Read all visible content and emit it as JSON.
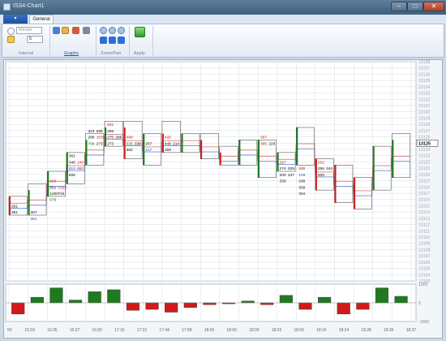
{
  "window": {
    "title": "ISS4-Chart1"
  },
  "tabs": {
    "file": "",
    "general": "General"
  },
  "ribbon": {
    "interval": {
      "group_label": "Interval",
      "unit": "Minute",
      "value": "5"
    },
    "graphs": {
      "group_label": "Graphs"
    },
    "zoom": {
      "group_label": "Zoom/Pan"
    },
    "apply": {
      "group_label": "Apply"
    }
  },
  "chart_data": {
    "type": "footprint-candlestick",
    "price_axis": {
      "ylim": [
        13103,
        13138
      ],
      "tick_labels": [
        "13138",
        "13137",
        "13136",
        "13135",
        "13134",
        "13133",
        "13132",
        "13131",
        "13130",
        "13129",
        "13128",
        "13127",
        "13126",
        "13125",
        "13124",
        "13123",
        "13122",
        "13121",
        "13120",
        "13119",
        "13118",
        "13117",
        "13116",
        "13115",
        "13114",
        "13113",
        "13112",
        "13111",
        "13110",
        "13109",
        "13108",
        "13107",
        "13106",
        "13105",
        "13104",
        "13103"
      ],
      "current_price_label": "13125"
    },
    "volume_axis": {
      "labels": [
        "1000",
        "0",
        "-1000"
      ]
    },
    "time_labels": [
      "50",
      "15:59",
      "16:35",
      "16:37",
      "16:50",
      "17:16",
      "17:31",
      "17:44",
      "17:58",
      "18:00",
      "18:00",
      "18:00",
      "18:03",
      "18:09",
      "18:16",
      "18:24",
      "18:28",
      "18:36",
      "18:37"
    ],
    "bars": [
      {
        "low": 13114,
        "high": 13116,
        "open": 13116,
        "close": 13114
      },
      {
        "low": 13114,
        "high": 13118,
        "open": 13114,
        "close": 13117
      },
      {
        "low": 13117,
        "high": 13120,
        "open": 13117,
        "close": 13120
      },
      {
        "low": 13119,
        "high": 13123,
        "open": 13119,
        "close": 13123
      },
      {
        "low": 13122,
        "high": 13126,
        "open": 13122,
        "close": 13125
      },
      {
        "low": 13125,
        "high": 13128,
        "open": 13125,
        "close": 13127
      },
      {
        "low": 13123,
        "high": 13128,
        "open": 13127,
        "close": 13123
      },
      {
        "low": 13122,
        "high": 13126,
        "open": 13122,
        "close": 13126
      },
      {
        "low": 13124,
        "high": 13128,
        "open": 13126,
        "close": 13124
      },
      {
        "low": 13124,
        "high": 13126,
        "open": 13124,
        "close": 13126
      },
      {
        "low": 13123,
        "high": 13126,
        "open": 13125,
        "close": 13123
      },
      {
        "low": 13122,
        "high": 13124,
        "open": 13123,
        "close": 13122
      },
      {
        "low": 13122,
        "high": 13125,
        "open": 13122,
        "close": 13125
      },
      {
        "low": 13120,
        "high": 13125,
        "open": 13120,
        "close": 13125
      },
      {
        "low": 13121,
        "high": 13123,
        "open": 13121,
        "close": 13123
      },
      {
        "low": 13122,
        "high": 13127,
        "open": 13122,
        "close": 13127
      },
      {
        "low": 13118,
        "high": 13122,
        "open": 13122,
        "close": 13118
      },
      {
        "low": 13116,
        "high": 13121,
        "open": 13121,
        "close": 13116
      },
      {
        "low": 13115,
        "high": 13119,
        "open": 13119,
        "close": 13115
      },
      {
        "low": 13118,
        "high": 13124,
        "open": 13118,
        "close": 13124
      },
      {
        "low": 13120,
        "high": 13126,
        "open": 13120,
        "close": 13125
      }
    ],
    "cell_labels": [
      {
        "bar": 0,
        "price": 13115,
        "text": "261",
        "color": "black"
      },
      {
        "bar": 0,
        "price": 13114,
        "text": "391",
        "color": "black"
      },
      {
        "bar": 1,
        "price": 13113,
        "text": "351",
        "color": "blue"
      },
      {
        "bar": 1,
        "price": 13114,
        "text": "307",
        "color": "black"
      },
      {
        "bar": 2,
        "price": 13119,
        "text": "620",
        "color": "red"
      },
      {
        "bar": 2,
        "price": 13118,
        "text": "551",
        "color": "black"
      },
      {
        "bar": 2,
        "price": 13118,
        "text": "1323",
        "color": "red"
      },
      {
        "bar": 2,
        "price": 13117,
        "text": "1200",
        "color": "black"
      },
      {
        "bar": 2,
        "price": 13117,
        "text": "734",
        "color": "black"
      },
      {
        "bar": 2,
        "price": 13116,
        "text": "679",
        "color": "green"
      },
      {
        "bar": 3,
        "price": 13123,
        "text": "361",
        "color": "black"
      },
      {
        "bar": 3,
        "price": 13122,
        "text": "348",
        "color": "black"
      },
      {
        "bar": 3,
        "price": 13122,
        "text": "249",
        "color": "red"
      },
      {
        "bar": 3,
        "price": 13121,
        "text": "613",
        "color": "blue"
      },
      {
        "bar": 3,
        "price": 13121,
        "text": "653",
        "color": "red"
      },
      {
        "bar": 3,
        "price": 13120,
        "text": "606",
        "color": "black"
      },
      {
        "bar": 4,
        "price": 13127,
        "text": "323",
        "color": "black"
      },
      {
        "bar": 4,
        "price": 13127,
        "text": "596",
        "color": "black"
      },
      {
        "bar": 4,
        "price": 13126,
        "text": "286",
        "color": "black"
      },
      {
        "bar": 4,
        "price": 13126,
        "text": "1039",
        "color": "red"
      },
      {
        "bar": 4,
        "price": 13125,
        "text": "796",
        "color": "green"
      },
      {
        "bar": 4,
        "price": 13125,
        "text": "273",
        "color": "black"
      },
      {
        "bar": 5,
        "price": 13128,
        "text": "602",
        "color": "red"
      },
      {
        "bar": 5,
        "price": 13127,
        "text": "269",
        "color": "black"
      },
      {
        "bar": 5,
        "price": 13126,
        "text": "275",
        "color": "black"
      },
      {
        "bar": 5,
        "price": 13126,
        "text": "286",
        "color": "black"
      },
      {
        "bar": 5,
        "price": 13125,
        "text": "273",
        "color": "black"
      },
      {
        "bar": 6,
        "price": 13126,
        "text": "498",
        "color": "red"
      },
      {
        "bar": 6,
        "price": 13125,
        "text": "535",
        "color": "green"
      },
      {
        "bar": 6,
        "price": 13125,
        "text": "338",
        "color": "black"
      },
      {
        "bar": 6,
        "price": 13124,
        "text": "582",
        "color": "black"
      },
      {
        "bar": 7,
        "price": 13125,
        "text": "257",
        "color": "black"
      },
      {
        "bar": 7,
        "price": 13124,
        "text": "217",
        "color": "blue"
      },
      {
        "bar": 8,
        "price": 13126,
        "text": "426",
        "color": "red"
      },
      {
        "bar": 8,
        "price": 13125,
        "text": "446",
        "color": "black"
      },
      {
        "bar": 8,
        "price": 13125,
        "text": "214",
        "color": "black"
      },
      {
        "bar": 8,
        "price": 13124,
        "text": "259",
        "color": "black"
      },
      {
        "bar": 13,
        "price": 13126,
        "text": "397",
        "color": "red"
      },
      {
        "bar": 13,
        "price": 13125,
        "text": "365",
        "color": "red"
      },
      {
        "bar": 13,
        "price": 13125,
        "text": "226",
        "color": "black"
      },
      {
        "bar": 14,
        "price": 13122,
        "text": "267",
        "color": "red"
      },
      {
        "bar": 14,
        "price": 13121,
        "text": "274",
        "color": "black"
      },
      {
        "bar": 14,
        "price": 13121,
        "text": "225",
        "color": "black"
      },
      {
        "bar": 14,
        "price": 13120,
        "text": "200",
        "color": "black"
      },
      {
        "bar": 14,
        "price": 13120,
        "text": "237",
        "color": "black"
      },
      {
        "bar": 14,
        "price": 13119,
        "text": "259",
        "color": "black"
      },
      {
        "bar": 15,
        "price": 13121,
        "text": "380",
        "color": "red"
      },
      {
        "bar": 15,
        "price": 13120,
        "text": "148",
        "color": "blue"
      },
      {
        "bar": 15,
        "price": 13119,
        "text": "298",
        "color": "black"
      },
      {
        "bar": 15,
        "price": 13118,
        "text": "358",
        "color": "black"
      },
      {
        "bar": 15,
        "price": 13117,
        "text": "304",
        "color": "black"
      },
      {
        "bar": 16,
        "price": 13122,
        "text": "252",
        "color": "red"
      },
      {
        "bar": 16,
        "price": 13121,
        "text": "255",
        "color": "black"
      },
      {
        "bar": 16,
        "price": 13121,
        "text": "244",
        "color": "black"
      },
      {
        "bar": 16,
        "price": 13120,
        "text": "205",
        "color": "black"
      }
    ],
    "delta": [
      -600,
      300,
      800,
      150,
      600,
      700,
      -400,
      -350,
      -500,
      -250,
      -100,
      -50,
      100,
      -100,
      400,
      -350,
      300,
      -600,
      -350,
      800,
      350
    ],
    "volume_ylim": [
      -1000,
      1000
    ]
  },
  "colors": {
    "up": "#1f7a1f",
    "down": "#d11a1a",
    "grid": "#d6dde5",
    "ribbon_accent": "#1d4f9e"
  }
}
